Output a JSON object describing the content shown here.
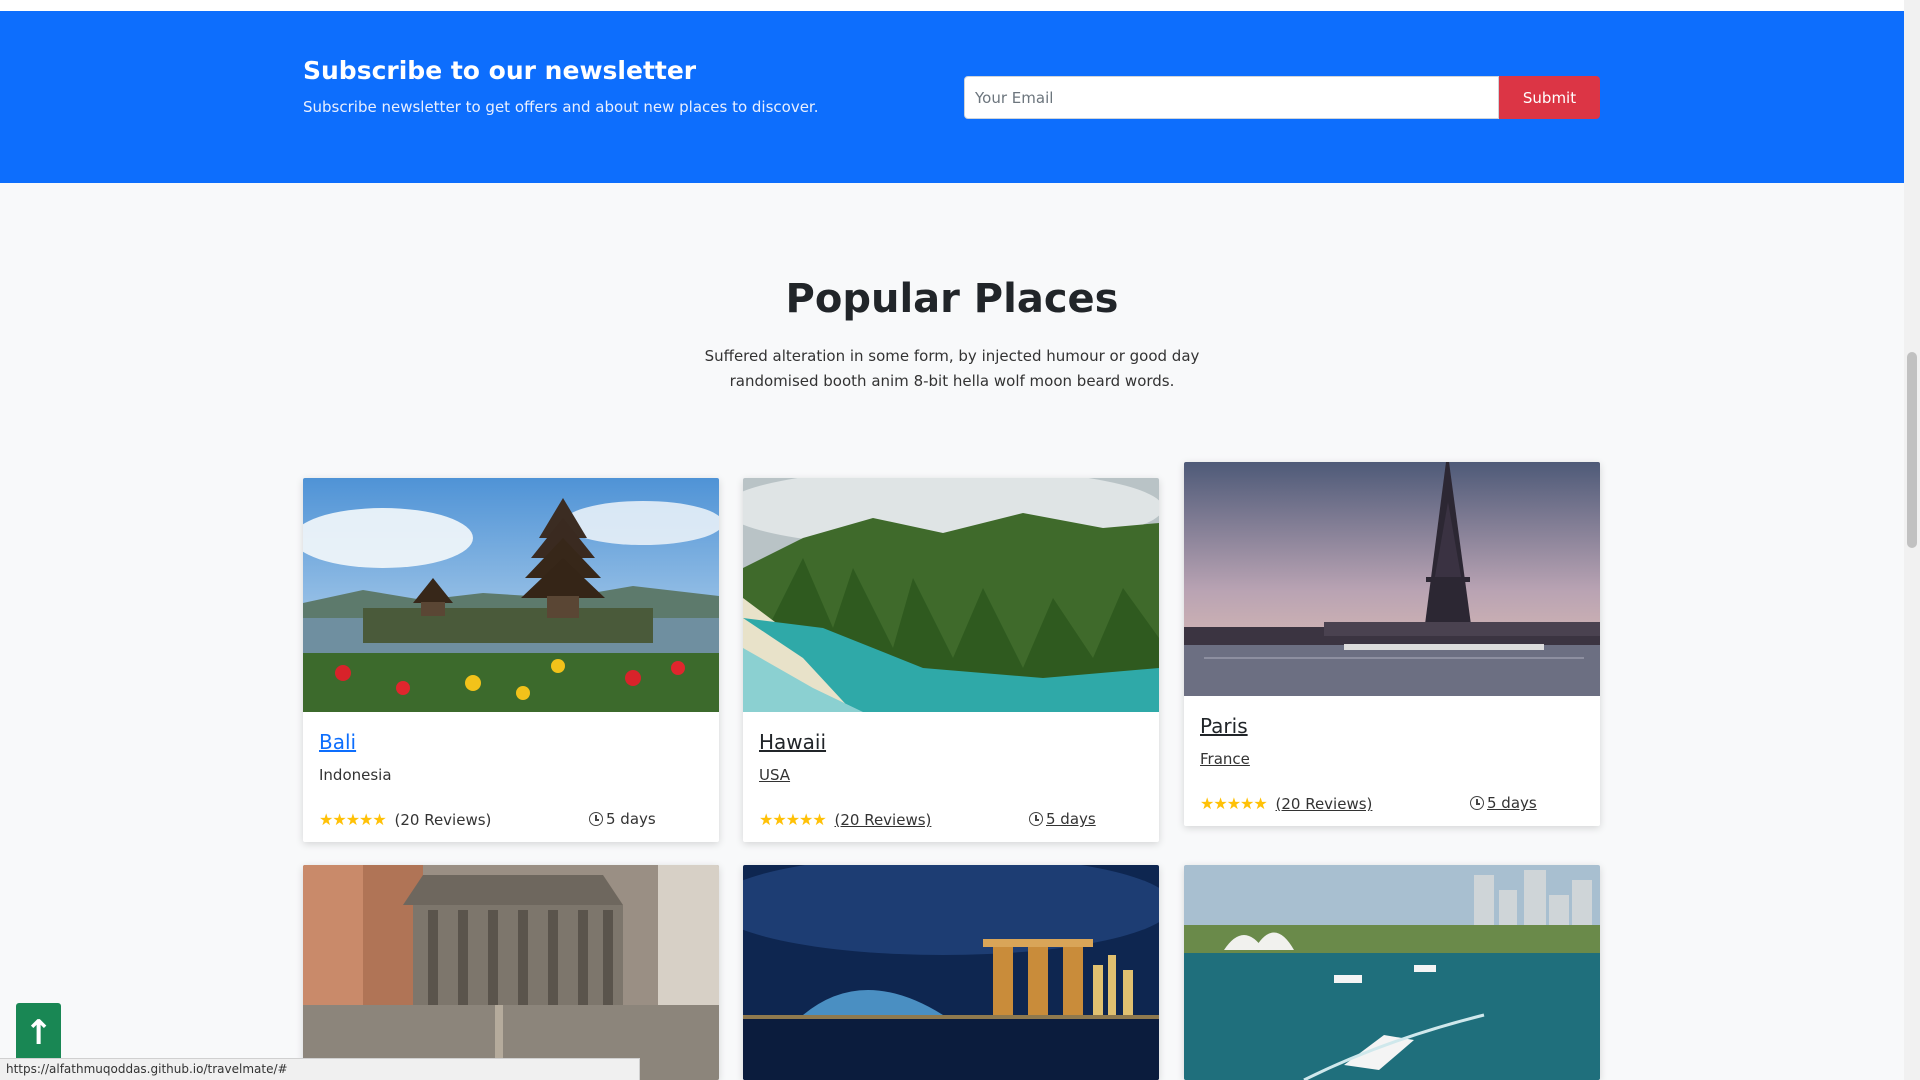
{
  "newsletter": {
    "title": "Subscribe to our newsletter",
    "subtitle": "Subscribe newsletter to get offers and about new places to discover.",
    "email_placeholder": "Your Email",
    "submit_label": "Submit"
  },
  "popular": {
    "title": "Popular Places",
    "subtitle": "Suffered alteration in some form, by injected humour or good day randomised booth anim 8-bit hella wolf moon beard words."
  },
  "cards": [
    {
      "title": "Bali",
      "country": "Indonesia",
      "stars": "★★★★★",
      "reviews": "(20 Reviews)",
      "days": "5 days"
    },
    {
      "title": "Hawaii",
      "country": "USA",
      "stars": "★★★★★",
      "reviews": "(20 Reviews)",
      "days": "5 days"
    },
    {
      "title": "Paris",
      "country": "France",
      "stars": "★★★★★",
      "reviews": "(20 Reviews)",
      "days": "5 days"
    }
  ],
  "back_to_top": {
    "icon": "arrow-up-icon",
    "glyph": "↑"
  },
  "status_url": "https://alfathmuqoddas.github.io/travelmate/#",
  "colors": {
    "primary": "#0d6efd",
    "danger": "#dc3545",
    "success": "#198754",
    "star": "#ffc107"
  }
}
